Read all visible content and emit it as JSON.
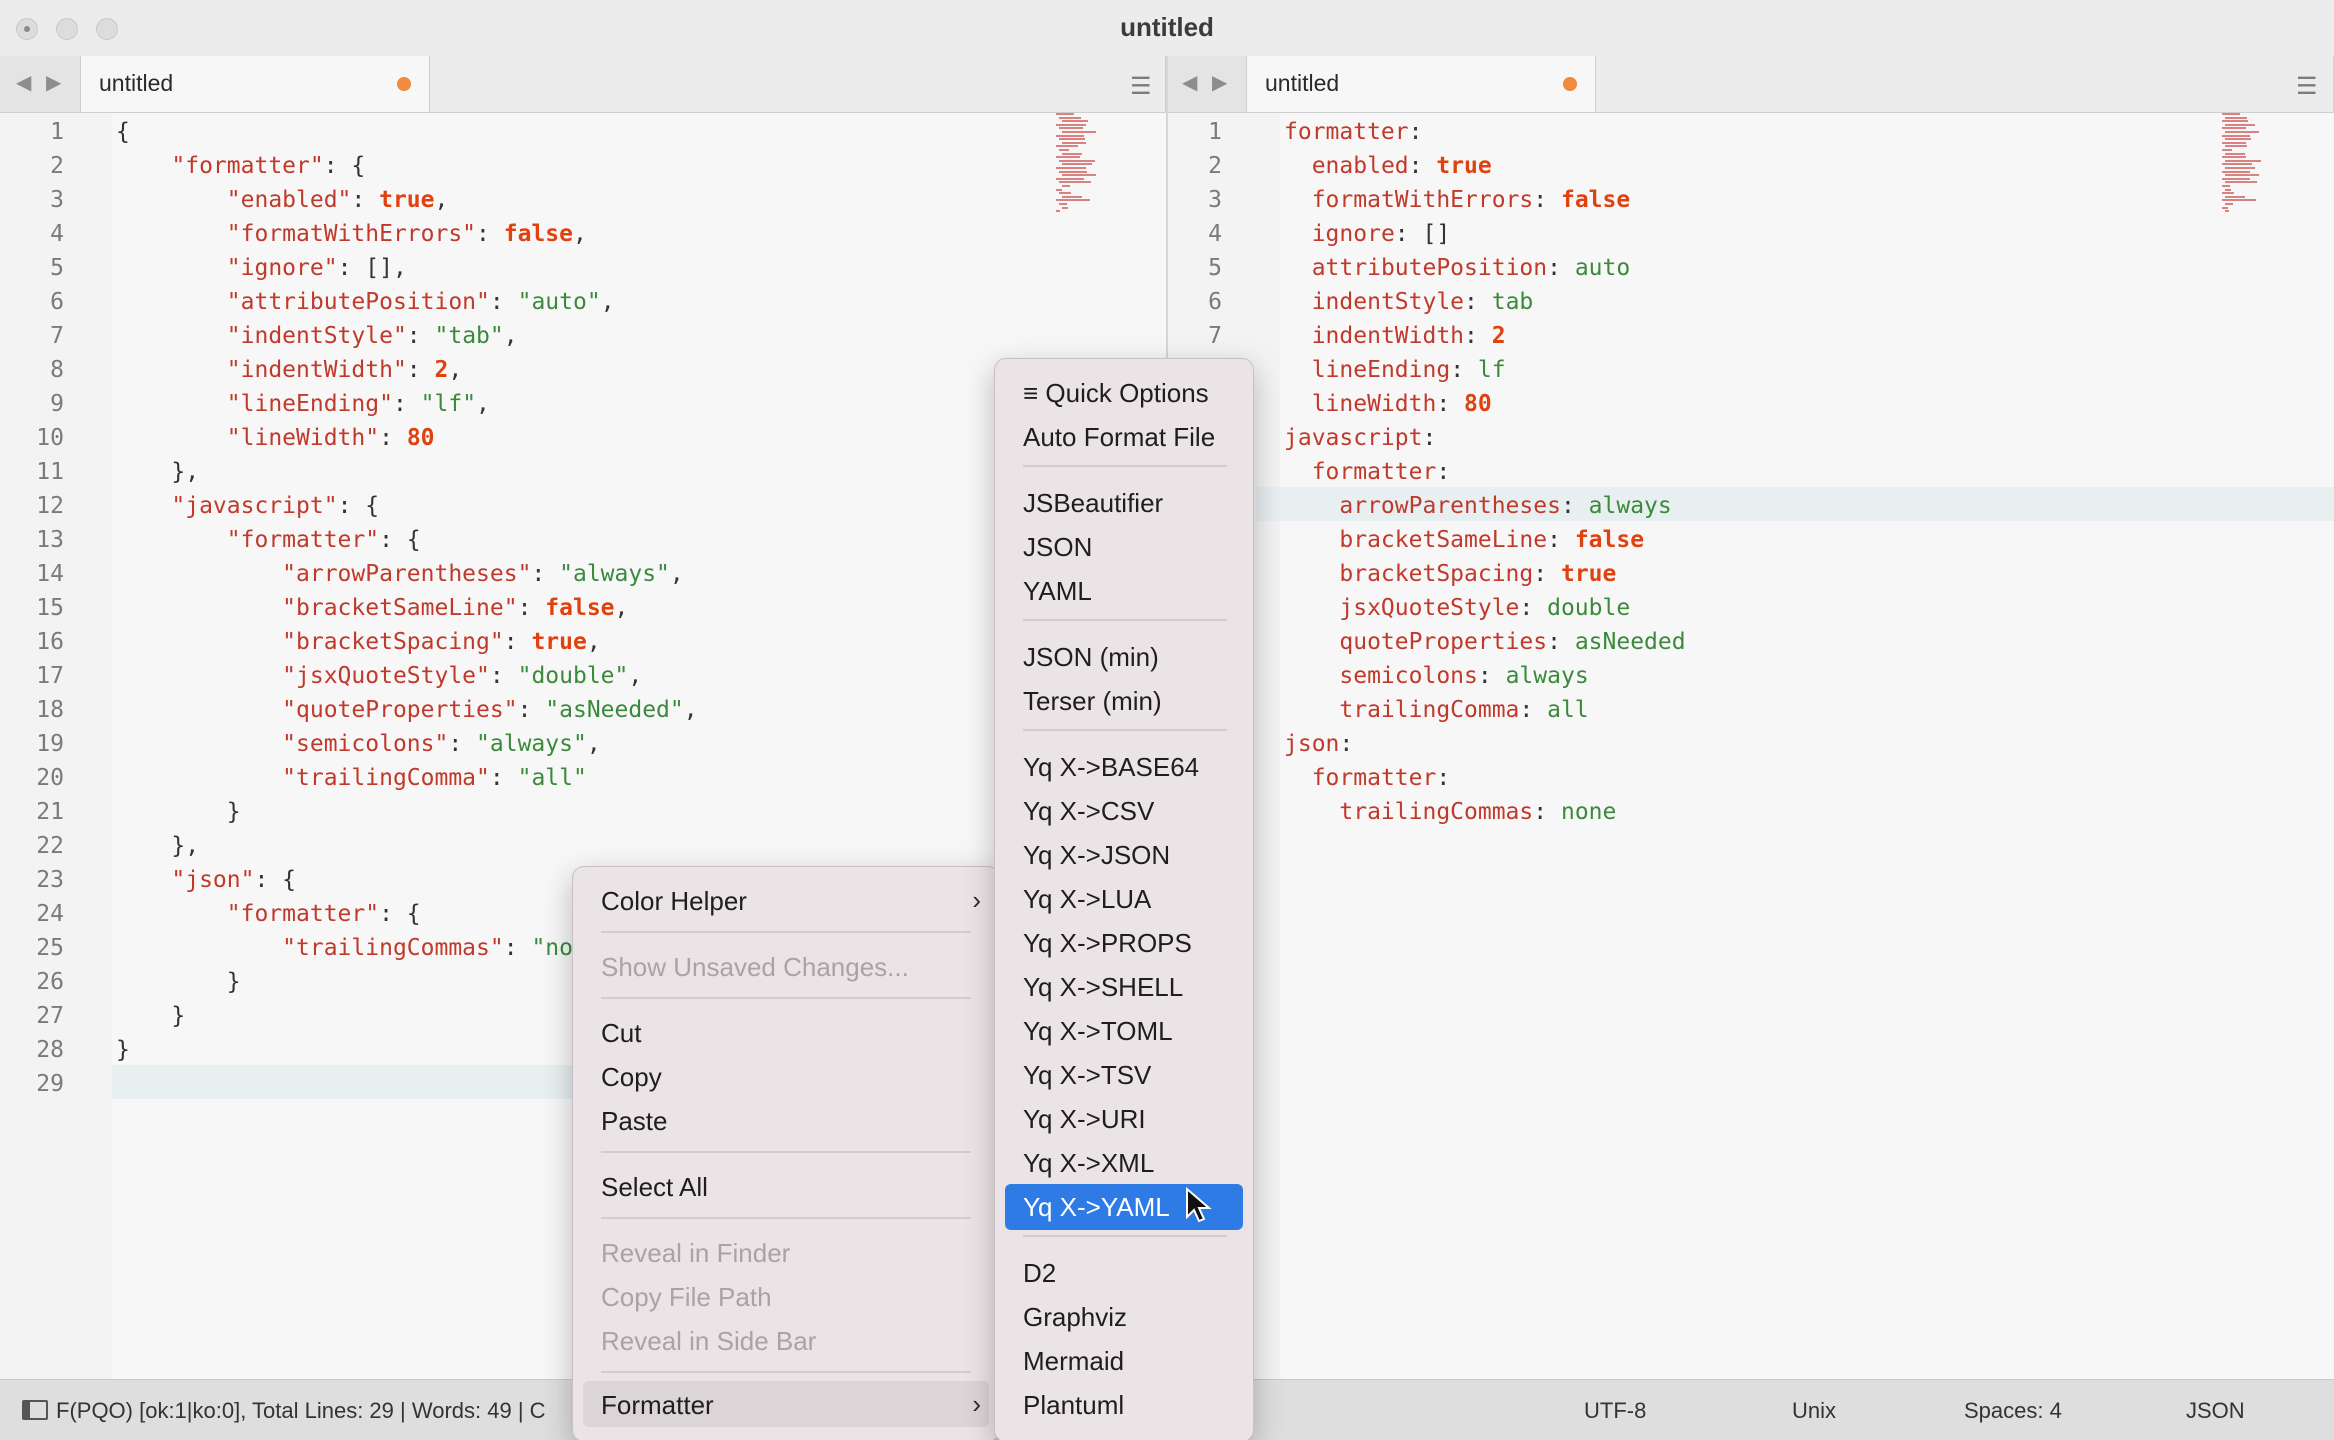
{
  "window": {
    "title": "untitled"
  },
  "left_pane": {
    "tab_label": "untitled",
    "lines": [
      [
        [
          "p",
          "{"
        ]
      ],
      [
        [
          "p",
          "    "
        ],
        [
          "k",
          "\"formatter\""
        ],
        [
          "p",
          ": {"
        ]
      ],
      [
        [
          "p",
          "        "
        ],
        [
          "k",
          "\"enabled\""
        ],
        [
          "p",
          ": "
        ],
        [
          "b",
          "true"
        ],
        [
          "p",
          ","
        ]
      ],
      [
        [
          "p",
          "        "
        ],
        [
          "k",
          "\"formatWithErrors\""
        ],
        [
          "p",
          ": "
        ],
        [
          "b",
          "false"
        ],
        [
          "p",
          ","
        ]
      ],
      [
        [
          "p",
          "        "
        ],
        [
          "k",
          "\"ignore\""
        ],
        [
          "p",
          ": [],"
        ]
      ],
      [
        [
          "p",
          "        "
        ],
        [
          "k",
          "\"attributePosition\""
        ],
        [
          "p",
          ": "
        ],
        [
          "s",
          "\"auto\""
        ],
        [
          "p",
          ","
        ]
      ],
      [
        [
          "p",
          "        "
        ],
        [
          "k",
          "\"indentStyle\""
        ],
        [
          "p",
          ": "
        ],
        [
          "s",
          "\"tab\""
        ],
        [
          "p",
          ","
        ]
      ],
      [
        [
          "p",
          "        "
        ],
        [
          "k",
          "\"indentWidth\""
        ],
        [
          "p",
          ": "
        ],
        [
          "b",
          "2"
        ],
        [
          "p",
          ","
        ]
      ],
      [
        [
          "p",
          "        "
        ],
        [
          "k",
          "\"lineEnding\""
        ],
        [
          "p",
          ": "
        ],
        [
          "s",
          "\"lf\""
        ],
        [
          "p",
          ","
        ]
      ],
      [
        [
          "p",
          "        "
        ],
        [
          "k",
          "\"lineWidth\""
        ],
        [
          "p",
          ": "
        ],
        [
          "b",
          "80"
        ]
      ],
      [
        [
          "p",
          "    },"
        ]
      ],
      [
        [
          "p",
          "    "
        ],
        [
          "k",
          "\"javascript\""
        ],
        [
          "p",
          ": {"
        ]
      ],
      [
        [
          "p",
          "        "
        ],
        [
          "k",
          "\"formatter\""
        ],
        [
          "p",
          ": {"
        ]
      ],
      [
        [
          "p",
          "            "
        ],
        [
          "k",
          "\"arrowParentheses\""
        ],
        [
          "p",
          ": "
        ],
        [
          "s",
          "\"always\""
        ],
        [
          "p",
          ","
        ]
      ],
      [
        [
          "p",
          "            "
        ],
        [
          "k",
          "\"bracketSameLine\""
        ],
        [
          "p",
          ": "
        ],
        [
          "b",
          "false"
        ],
        [
          "p",
          ","
        ]
      ],
      [
        [
          "p",
          "            "
        ],
        [
          "k",
          "\"bracketSpacing\""
        ],
        [
          "p",
          ": "
        ],
        [
          "b",
          "true"
        ],
        [
          "p",
          ","
        ]
      ],
      [
        [
          "p",
          "            "
        ],
        [
          "k",
          "\"jsxQuoteStyle\""
        ],
        [
          "p",
          ": "
        ],
        [
          "s",
          "\"double\""
        ],
        [
          "p",
          ","
        ]
      ],
      [
        [
          "p",
          "            "
        ],
        [
          "k",
          "\"quoteProperties\""
        ],
        [
          "p",
          ": "
        ],
        [
          "s",
          "\"asNeeded\""
        ],
        [
          "p",
          ","
        ]
      ],
      [
        [
          "p",
          "            "
        ],
        [
          "k",
          "\"semicolons\""
        ],
        [
          "p",
          ": "
        ],
        [
          "s",
          "\"always\""
        ],
        [
          "p",
          ","
        ]
      ],
      [
        [
          "p",
          "            "
        ],
        [
          "k",
          "\"trailingComma\""
        ],
        [
          "p",
          ": "
        ],
        [
          "s",
          "\"all\""
        ]
      ],
      [
        [
          "p",
          "        }"
        ]
      ],
      [
        [
          "p",
          "    },"
        ]
      ],
      [
        [
          "p",
          "    "
        ],
        [
          "k",
          "\"json\""
        ],
        [
          "p",
          ": {"
        ]
      ],
      [
        [
          "p",
          "        "
        ],
        [
          "k",
          "\"formatter\""
        ],
        [
          "p",
          ": {"
        ]
      ],
      [
        [
          "p",
          "            "
        ],
        [
          "k",
          "\"trailingCommas\""
        ],
        [
          "p",
          ": "
        ],
        [
          "s",
          "\"no"
        ]
      ],
      [
        [
          "p",
          "        }"
        ]
      ],
      [
        [
          "p",
          "    }"
        ]
      ],
      [
        [
          "p",
          "}"
        ]
      ],
      [
        [
          "p",
          ""
        ]
      ]
    ]
  },
  "right_pane": {
    "tab_label": "untitled",
    "lines": [
      [
        [
          "k",
          "formatter"
        ],
        [
          "p",
          ":"
        ]
      ],
      [
        [
          "p",
          "  "
        ],
        [
          "k",
          "enabled"
        ],
        [
          "p",
          ": "
        ],
        [
          "b",
          "true"
        ]
      ],
      [
        [
          "p",
          "  "
        ],
        [
          "k",
          "formatWithErrors"
        ],
        [
          "p",
          ": "
        ],
        [
          "b",
          "false"
        ]
      ],
      [
        [
          "p",
          "  "
        ],
        [
          "k",
          "ignore"
        ],
        [
          "p",
          ": []"
        ]
      ],
      [
        [
          "p",
          "  "
        ],
        [
          "k",
          "attributePosition"
        ],
        [
          "p",
          ": "
        ],
        [
          "s",
          "auto"
        ]
      ],
      [
        [
          "p",
          "  "
        ],
        [
          "k",
          "indentStyle"
        ],
        [
          "p",
          ": "
        ],
        [
          "s",
          "tab"
        ]
      ],
      [
        [
          "p",
          "  "
        ],
        [
          "k",
          "indentWidth"
        ],
        [
          "p",
          ": "
        ],
        [
          "b",
          "2"
        ]
      ],
      [
        [
          "p",
          "  "
        ],
        [
          "k",
          "lineEnding"
        ],
        [
          "p",
          ": "
        ],
        [
          "s",
          "lf"
        ]
      ],
      [
        [
          "p",
          "  "
        ],
        [
          "k",
          "lineWidth"
        ],
        [
          "p",
          ": "
        ],
        [
          "b",
          "80"
        ]
      ],
      [
        [
          "k",
          "javascript"
        ],
        [
          "p",
          ":"
        ]
      ],
      [
        [
          "p",
          "  "
        ],
        [
          "k",
          "formatter"
        ],
        [
          "p",
          ":"
        ]
      ],
      [
        [
          "p",
          "    "
        ],
        [
          "k",
          "arrowParentheses"
        ],
        [
          "p",
          ": "
        ],
        [
          "s",
          "always"
        ]
      ],
      [
        [
          "p",
          "    "
        ],
        [
          "k",
          "bracketSameLine"
        ],
        [
          "p",
          ": "
        ],
        [
          "b",
          "false"
        ]
      ],
      [
        [
          "p",
          "    "
        ],
        [
          "k",
          "bracketSpacing"
        ],
        [
          "p",
          ": "
        ],
        [
          "b",
          "true"
        ]
      ],
      [
        [
          "p",
          "    "
        ],
        [
          "k",
          "jsxQuoteStyle"
        ],
        [
          "p",
          ": "
        ],
        [
          "s",
          "double"
        ]
      ],
      [
        [
          "p",
          "    "
        ],
        [
          "k",
          "quoteProperties"
        ],
        [
          "p",
          ": "
        ],
        [
          "s",
          "asNeeded"
        ]
      ],
      [
        [
          "p",
          "    "
        ],
        [
          "k",
          "semicolons"
        ],
        [
          "p",
          ": "
        ],
        [
          "s",
          "always"
        ]
      ],
      [
        [
          "p",
          "    "
        ],
        [
          "k",
          "trailingComma"
        ],
        [
          "p",
          ": "
        ],
        [
          "s",
          "all"
        ]
      ],
      [
        [
          "k",
          "json"
        ],
        [
          "p",
          ":"
        ]
      ],
      [
        [
          "p",
          "  "
        ],
        [
          "k",
          "formatter"
        ],
        [
          "p",
          ":"
        ]
      ],
      [
        [
          "p",
          "    "
        ],
        [
          "k",
          "trailingCommas"
        ],
        [
          "p",
          ": "
        ],
        [
          "s",
          "none"
        ]
      ]
    ]
  },
  "status_bar": {
    "left_text": "F(PQO) [ok:1|ko:0], Total Lines: 29 | Words: 49 | C",
    "encoding": "UTF-8",
    "line_endings": "Unix",
    "indentation": "Spaces: 4",
    "syntax": "JSON"
  },
  "context_menu": {
    "color_helper": "Color Helper",
    "show_unsaved": "Show Unsaved Changes...",
    "cut": "Cut",
    "copy": "Copy",
    "paste": "Paste",
    "select_all": "Select All",
    "reveal_finder": "Reveal in Finder",
    "copy_file_path": "Copy File Path",
    "reveal_sidebar": "Reveal in Side Bar",
    "formatter": "Formatter"
  },
  "formatter_submenu": {
    "quick_options": "≡ Quick Options",
    "auto_format": "Auto Format File",
    "group_a": [
      "JSBeautifier",
      "JSON",
      "YAML"
    ],
    "group_b": [
      "JSON (min)",
      "Terser (min)"
    ],
    "group_c": [
      "Yq X->BASE64",
      "Yq X->CSV",
      "Yq X->JSON",
      "Yq X->LUA",
      "Yq X->PROPS",
      "Yq X->SHELL",
      "Yq X->TOML",
      "Yq X->TSV",
      "Yq X->URI",
      "Yq X->XML",
      "Yq X->YAML"
    ],
    "group_d": [
      "D2",
      "Graphviz",
      "Mermaid",
      "Plantuml"
    ],
    "selected": "Yq X->YAML"
  },
  "colors": {
    "key": "#c03a2b",
    "string": "#3b8a3b",
    "literal": "#e0420f",
    "selection": "#2e7be6",
    "dirty_dot": "#f08a3c"
  }
}
